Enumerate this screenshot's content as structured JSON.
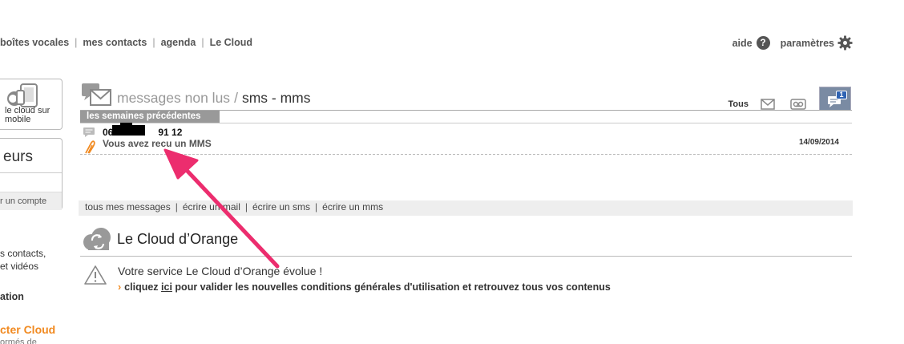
{
  "topnav": {
    "items": [
      "boîtes vocales",
      "mes contacts",
      "agenda",
      "Le Cloud"
    ],
    "help_label": "aide",
    "help_icon": "question-mark-icon",
    "settings_label": "paramètres",
    "settings_icon": "gear-icon"
  },
  "sidebar": {
    "cloud_mobile_label": "le cloud sur mobile",
    "box_title": "eurs",
    "box_footer": "r un compte",
    "text1": "s contacts,",
    "text2": "et vidéos",
    "bold1": "ation",
    "orange1": "cter Cloud",
    "cut": "ormés de"
  },
  "messages": {
    "title_muted": "messages non lus",
    "title_sep": "/",
    "title_main": "sms - mms",
    "filter_all": "Tous",
    "filter_badge": "1",
    "week_label": "les semaines précédentes",
    "row": {
      "sender_prefix": "06",
      "sender_suffix": "91 12",
      "subject": "Vous avez recu un MMS",
      "date": "14/09/2014"
    }
  },
  "actions": [
    "tous mes messages",
    "écrire un mail",
    "écrire un sms",
    "écrire un mms"
  ],
  "cloud": {
    "title": "Le Cloud d’Orange",
    "notice": "Votre service Le Cloud d’Orange évolue !",
    "cta_pre": "cliquez",
    "cta_link": "ici",
    "cta_post": "pour valider les nouvelles conditions générales d'utilisation et retrouvez tous vos contenus"
  },
  "colors": {
    "accent_orange": "#f18a21",
    "annotation_arrow": "#ec2d6e",
    "active_filter": "#7a8ba3"
  }
}
